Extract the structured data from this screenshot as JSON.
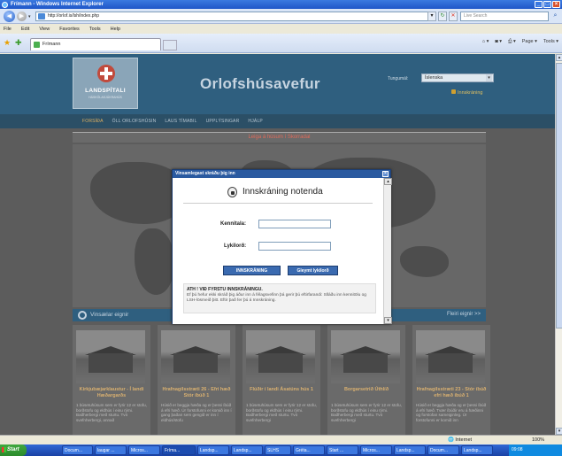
{
  "browser": {
    "title": "Frímann - Windows Internet Explorer",
    "address": "http://orlof.is/lsh/index.php",
    "search_placeholder": "Live Search",
    "menu": [
      "File",
      "Edit",
      "View",
      "Favorites",
      "Tools",
      "Help"
    ],
    "tab_label": "Frímann",
    "commands": [
      "Page ▾",
      "Tools ▾"
    ],
    "status_zone": "Internet",
    "zoom": "100%"
  },
  "site": {
    "logo_text": "LANDSPÍTALI",
    "logo_sub": "HÁSKÓLASJÚKRAHÚS",
    "title": "Orlofshúsavefur",
    "language_label": "Tungumál:",
    "language_value": "Íslenska",
    "login_link": "Innskráning",
    "nav": [
      "FORSÍÐA",
      "ÖLL ORLOFSHÚSIN",
      "LAUS TÍMABIL",
      "UPPLÝSINGAR",
      "HJÁLP"
    ],
    "banner": "Leiga á húsum í Skorradal",
    "recent_title": "Vinsælar eignir",
    "recent_more": "Fleiri eignir >>"
  },
  "cards": [
    {
      "title": "Kirkjubæjarklaustur - Í landi Hæðargarðs",
      "desc": "1 búsetuhúsum sem er fyrir 12 er stofu, borðstofu og eldhús í einu rými. Baðherbergi með sturtu. Tvö svefnherbergi, annað"
    },
    {
      "title": "Hrafnagilsstræti 26 - Efri hæð Stór íbúð 1",
      "desc": "Húsið er beggja hæða og er þessi íbúð á efri hæð. Úr forstofunni er komið inn í gang þaðan sem gengið er inn í eldhús/stofu"
    },
    {
      "title": "Flúðir í landi Ásatúns hús 1",
      "desc": "1 búsetuhúsum sem er fyrir 12 er stofu, borðstofu og eldhús í einu rými. Baðherbergi með sturtu. Tvö svefnherbergi"
    },
    {
      "title": "Borgarsetrið Úthlíð",
      "desc": "1 búsetuhúsum sem er fyrir 12 er stofu, borðstofu og eldhús í einu rými. Baðherbergi með sturtu. Tvö svefnherbergi"
    },
    {
      "title": "Hrafnagilsstræti 23 - Stór íbúð efri hæð íbúð 1",
      "desc": "Húsið er beggja hæða og er þessi íbúð á efri hæð. Tvær íbúðir eru á hæðinni og forstofan sameiginleg. Úr forstofunni er komið inn"
    }
  ],
  "dialog": {
    "header": "Vinsamlegast skráðu þig inn",
    "title": "Innskráning notenda",
    "kennitala_label": "Kennitala:",
    "password_label": "Lykilorð:",
    "login_button": "INNSKRÁNING",
    "forgot_button": "Gleymt lykilorð",
    "note_head": "ATH ! VIÐ FYRSTU INNSKRÁNINGU.",
    "note_text": "Ef þú hefur ekki skráð þig áður inn á félagsvefinn þá gerir þú eftirfarandi: Slláðu inn kennitölu og LSH-lösmeið þitt. Eftir það fer þú á Innskráning."
  },
  "taskbar": {
    "start": "Start",
    "items": [
      "Docum...",
      "laugar ...",
      "Micros...",
      "Fríma...",
      "Landsp...",
      "Landsp...",
      "SLHS",
      "Gréta...",
      "Start ...",
      "Micros...",
      "Landsp...",
      "Docum...",
      "Landsp..."
    ],
    "clock": "09:08"
  }
}
